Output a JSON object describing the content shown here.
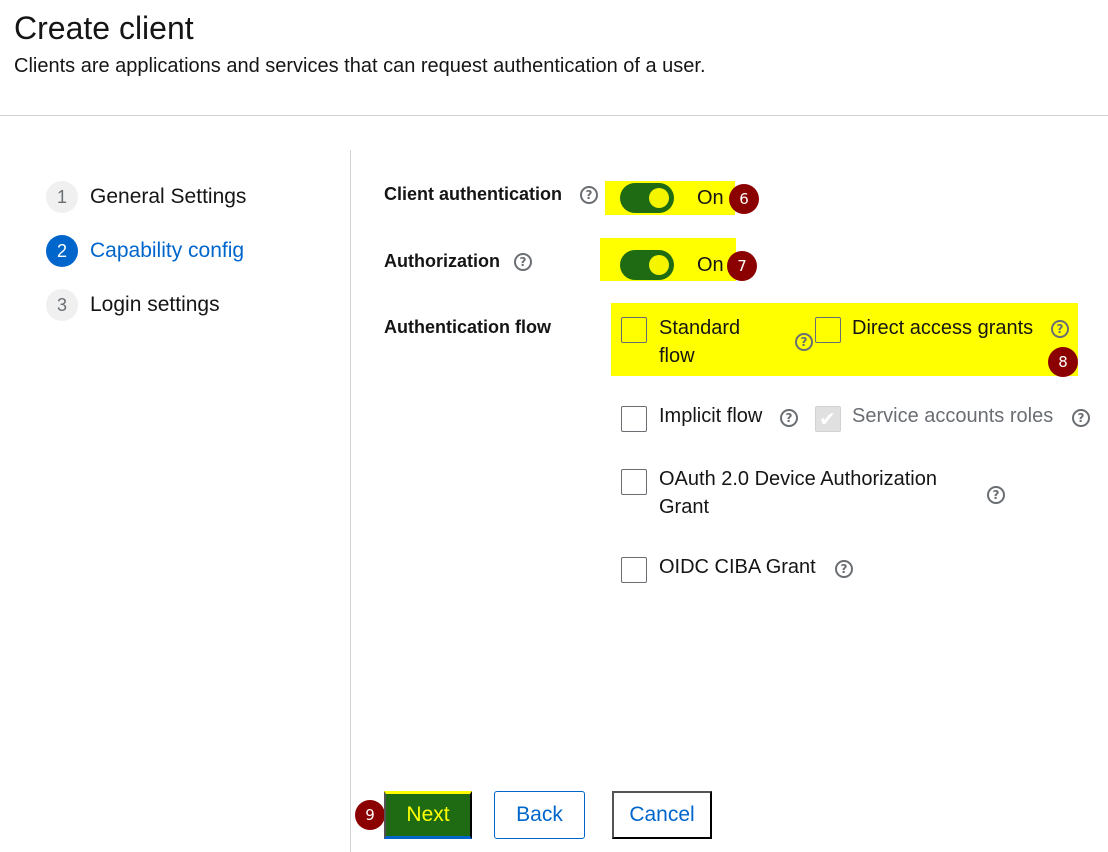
{
  "header": {
    "title": "Create client",
    "subtitle": "Clients are applications and services that can request authentication of a user."
  },
  "wizard": {
    "steps": [
      {
        "number": "1",
        "label": "General Settings",
        "active": false
      },
      {
        "number": "2",
        "label": "Capability config",
        "active": true
      },
      {
        "number": "3",
        "label": "Login settings",
        "active": false
      }
    ]
  },
  "form": {
    "client_auth": {
      "label": "Client authentication",
      "state": "On",
      "badge": "6"
    },
    "authorization": {
      "label": "Authorization",
      "state": "On",
      "badge": "7"
    },
    "auth_flow": {
      "label": "Authentication flow",
      "badge": "8",
      "options": {
        "standard_flow_line1": "Standard",
        "standard_flow_line2": "flow",
        "direct_access": "Direct access grants",
        "implicit": "Implicit flow",
        "service_accounts": "Service accounts roles",
        "device_line1": "OAuth 2.0 Device Authorization",
        "device_line2": "Grant",
        "ciba": "OIDC CIBA Grant"
      }
    }
  },
  "footer": {
    "badge": "9",
    "next_label": "Next",
    "back_label": "Back",
    "cancel_label": "Cancel"
  },
  "colors": {
    "highlight": "#ffff00",
    "toggle_on": "#1e6b14",
    "primary": "#0066cc",
    "badge": "#8b0000"
  },
  "icons": {
    "help": "?",
    "check": "✔"
  }
}
